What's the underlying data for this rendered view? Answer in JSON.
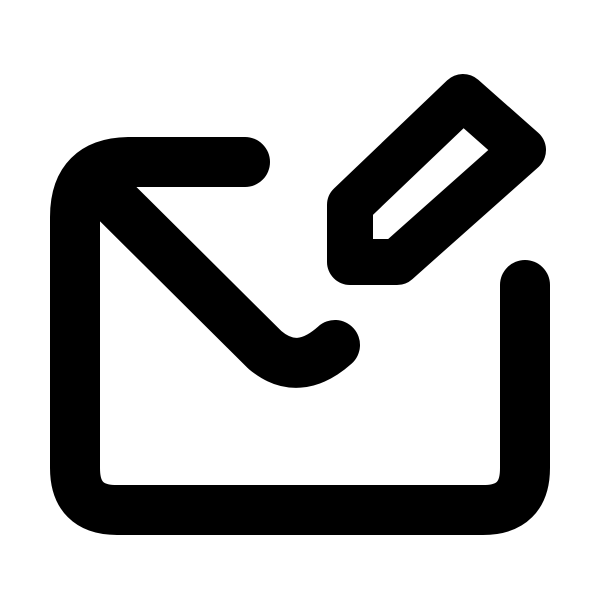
{
  "icon": {
    "name": "mail-edit-icon",
    "stroke_color": "#000000",
    "background_color": "#ffffff"
  }
}
